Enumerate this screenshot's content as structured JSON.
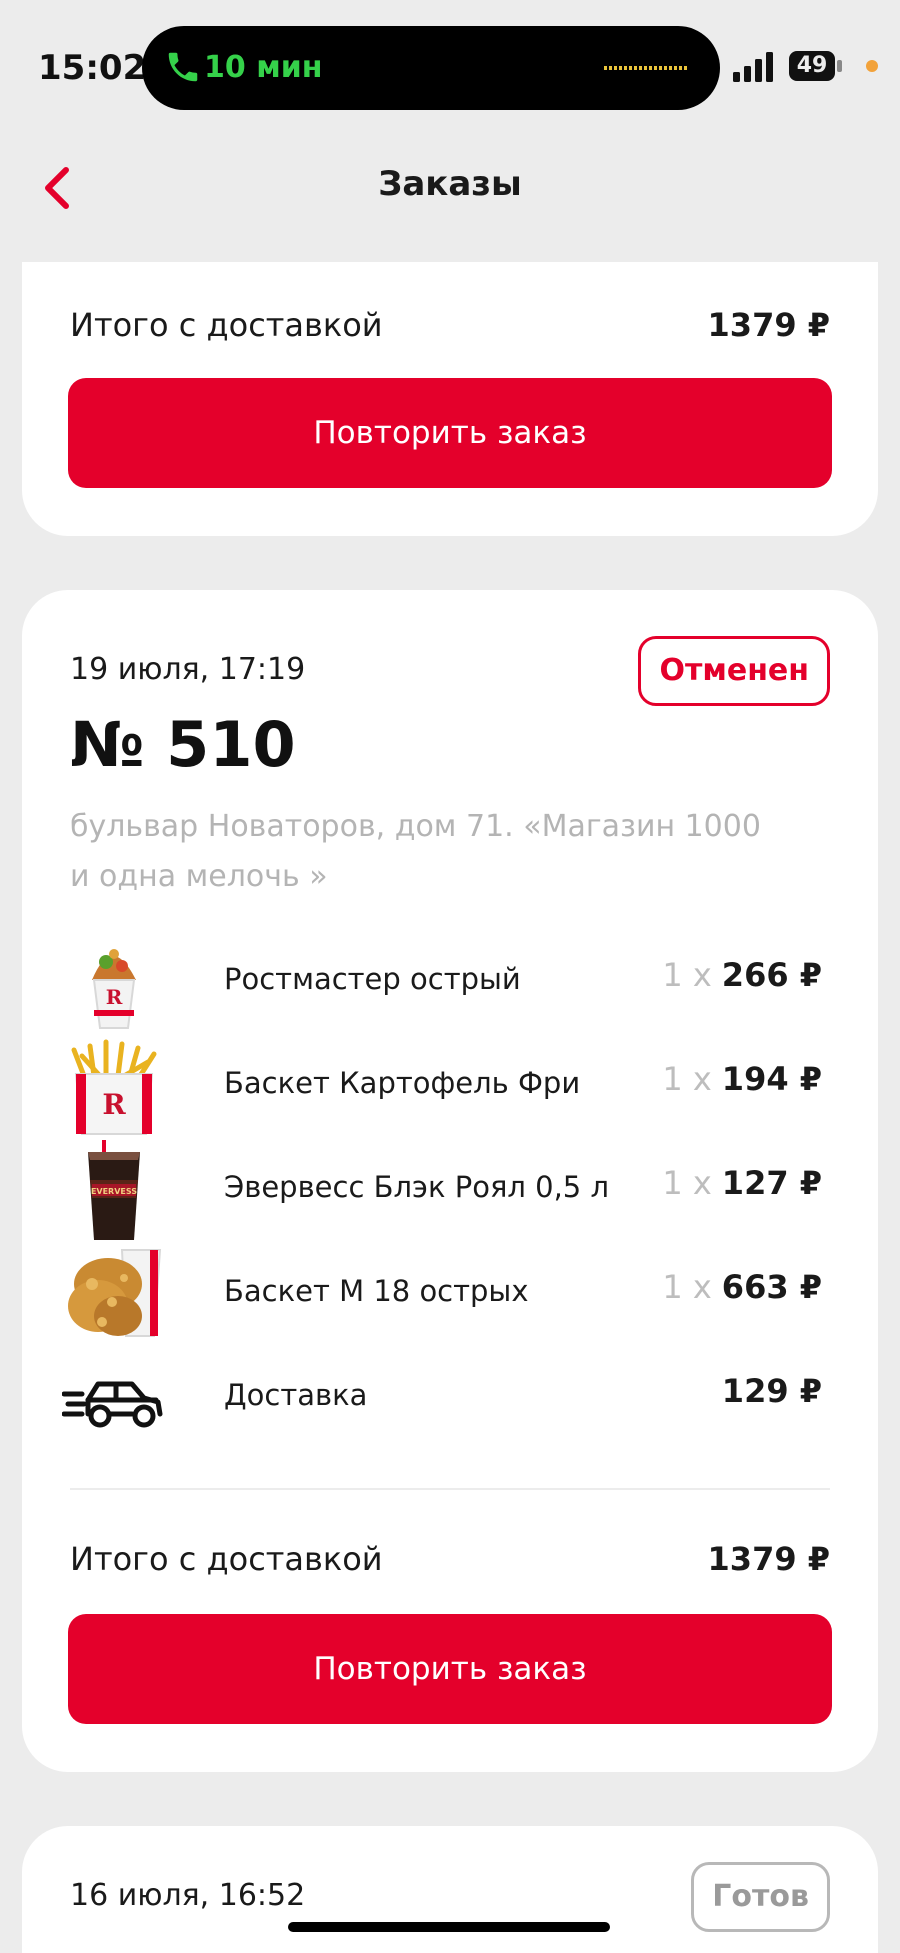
{
  "status_bar": {
    "time": "15:02",
    "call_duration": "10 мин",
    "battery": "49",
    "icons": [
      "phone-icon",
      "waveform-icon",
      "signal-icon",
      "battery-icon"
    ]
  },
  "header": {
    "back_icon": "chevron-left-icon",
    "title": "Заказы"
  },
  "colors": {
    "accent": "#e4002b",
    "background": "#ececec",
    "card": "#ffffff",
    "muted": "#b4b4b4",
    "call_green": "#35d14a"
  },
  "previous_order": {
    "total_label": "Итого с доставкой",
    "total_value": "1379 ₽",
    "repeat_label": "Повторить заказ"
  },
  "order": {
    "date": "19 июля, 17:19",
    "status": "Отменен",
    "number": "№ 510",
    "address_line1": "бульвар Новаторов, дом 71. «Магазин 1000",
    "address_line2": "и одна мелочь »",
    "items": [
      {
        "name": "Ростмастер острый",
        "qty": "1 х",
        "price": "266 ₽",
        "icon": "wrap-icon"
      },
      {
        "name": "Баскет Картофель Фри",
        "qty": "1 х",
        "price": "194 ₽",
        "icon": "fries-icon"
      },
      {
        "name": "Эвервесс Блэк Роял 0,5 л",
        "qty": "1 х",
        "price": "127 ₽",
        "icon": "drink-icon"
      },
      {
        "name": "Баскет М 18 острых",
        "qty": "1 х",
        "price": "663 ₽",
        "icon": "chicken-bucket-icon"
      },
      {
        "name": "Доставка",
        "qty": "",
        "price": "129 ₽",
        "icon": "delivery-car-icon"
      }
    ],
    "total_label": "Итого с доставкой",
    "total_value": "1379 ₽",
    "repeat_label": "Повторить заказ"
  },
  "next_order": {
    "date": "16 июля, 16:52",
    "status": "Готов"
  }
}
